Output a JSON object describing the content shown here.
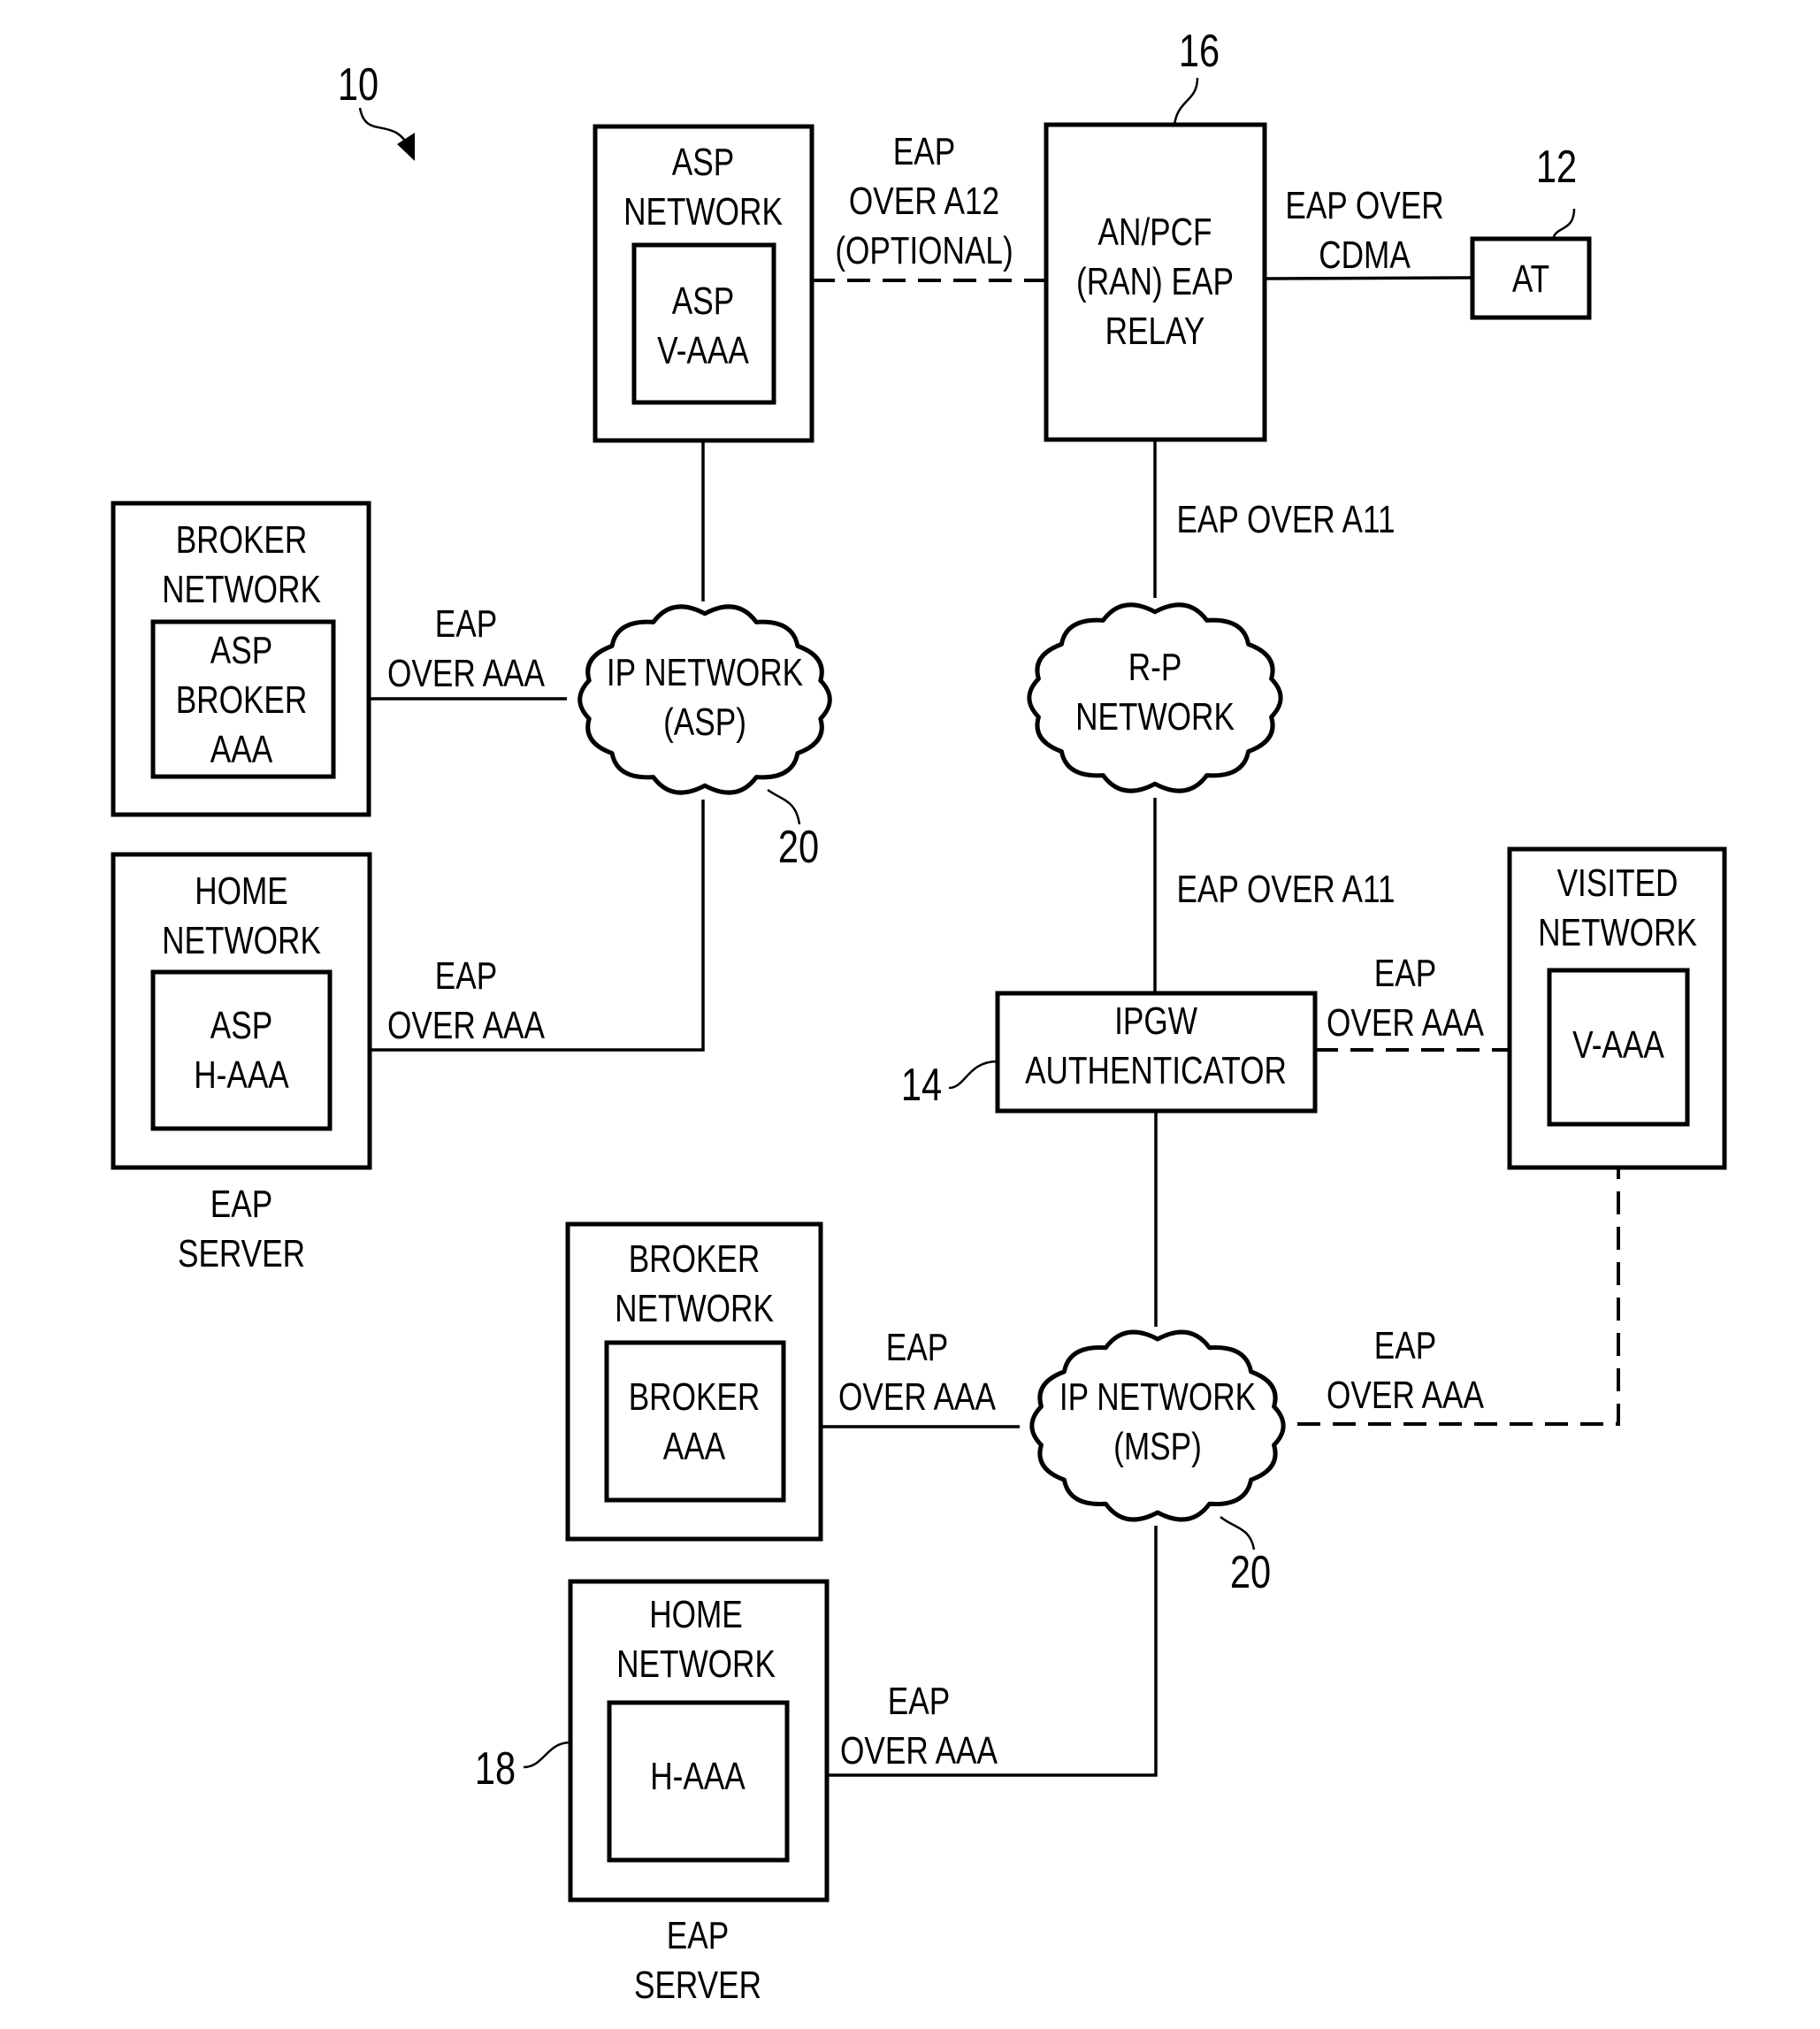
{
  "figure": {
    "reference_numeral": "10",
    "accent_color": "#000000",
    "background_color": "#ffffff"
  },
  "nodes": {
    "asp_network": {
      "title": [
        "ASP",
        "NETWORK"
      ],
      "inner": [
        "ASP",
        "V-AAA"
      ]
    },
    "an_pcf": {
      "label": [
        "AN/PCF",
        "(RAN) EAP",
        "RELAY"
      ],
      "ref": "16"
    },
    "at": {
      "label": [
        "AT"
      ],
      "ref": "12"
    },
    "broker_network_asp": {
      "title": [
        "BROKER",
        "NETWORK"
      ],
      "inner": [
        "ASP",
        "BROKER",
        "AAA"
      ]
    },
    "home_network_asp": {
      "title": [
        "HOME",
        "NETWORK"
      ],
      "inner": [
        "ASP",
        "H-AAA"
      ],
      "caption": [
        "EAP",
        "SERVER"
      ]
    },
    "ip_network_asp": {
      "label": [
        "IP NETWORK",
        "(ASP)"
      ],
      "ref": "20"
    },
    "rp_network": {
      "label": [
        "R-P",
        "NETWORK"
      ]
    },
    "ipgw": {
      "label": [
        "IPGW",
        "AUTHENTICATOR"
      ],
      "ref": "14"
    },
    "visited_network": {
      "title": [
        "VISITED",
        "NETWORK"
      ],
      "inner": [
        "V-AAA"
      ]
    },
    "broker_network_msp": {
      "title": [
        "BROKER",
        "NETWORK"
      ],
      "inner": [
        "BROKER",
        "AAA"
      ]
    },
    "ip_network_msp": {
      "label": [
        "IP NETWORK",
        "(MSP)"
      ],
      "ref": "20"
    },
    "home_network_msp": {
      "title": [
        "HOME",
        "NETWORK"
      ],
      "inner": [
        "H-AAA"
      ],
      "caption": [
        "EAP",
        "SERVER"
      ],
      "ref": "18"
    }
  },
  "links": {
    "asp_to_anpcf": {
      "label": [
        "EAP",
        "OVER A12",
        "(OPTIONAL)"
      ],
      "style": "dashed"
    },
    "anpcf_to_at": {
      "label": [
        "EAP OVER",
        "CDMA"
      ],
      "style": "solid"
    },
    "anpcf_to_rp": {
      "label": [
        "EAP OVER A11"
      ],
      "style": "solid"
    },
    "rp_to_ipgw": {
      "label": [
        "EAP OVER A11"
      ],
      "style": "solid"
    },
    "broker_asp_to_ipasp": {
      "label": [
        "EAP",
        "OVER AAA"
      ],
      "style": "solid"
    },
    "home_asp_to_ipasp": {
      "label": [
        "EAP",
        "OVER AAA"
      ],
      "style": "solid"
    },
    "ipgw_to_visited": {
      "label": [
        "EAP",
        "OVER AAA"
      ],
      "style": "dashed"
    },
    "broker_msp_to_ipmsp": {
      "label": [
        "EAP",
        "OVER AAA"
      ],
      "style": "solid"
    },
    "ipmsp_to_visited": {
      "label": [
        "EAP",
        "OVER AAA"
      ],
      "style": "dashed"
    },
    "home_msp_to_ipmsp": {
      "label": [
        "EAP",
        "OVER AAA"
      ],
      "style": "solid"
    }
  }
}
